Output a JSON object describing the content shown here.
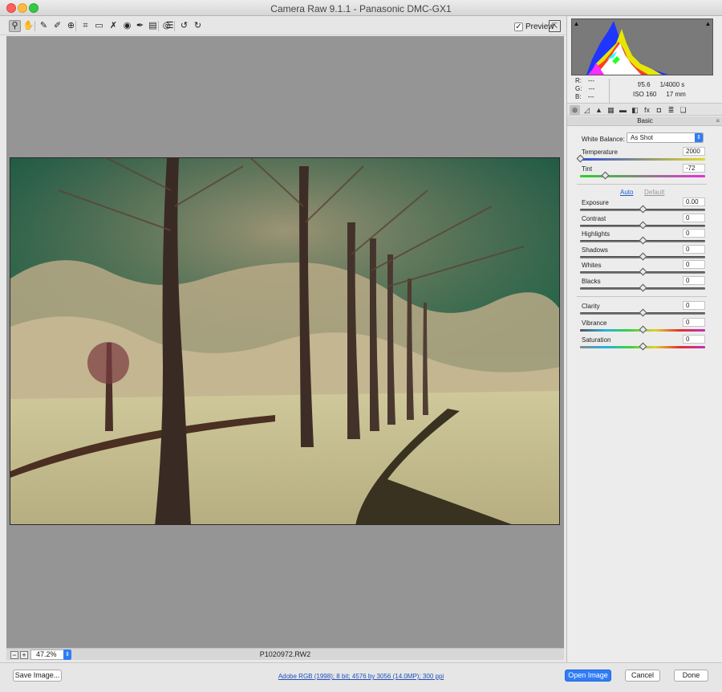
{
  "window": {
    "title": "Camera Raw 9.1.1  -  Panasonic DMC-GX1"
  },
  "toolbar": {
    "tools": [
      {
        "name": "zoom-tool",
        "icon": "magnifier-icon",
        "glyph": "⚲"
      },
      {
        "name": "hand-tool",
        "icon": "hand-icon",
        "glyph": "✋"
      },
      {
        "name": "white-balance-tool",
        "icon": "eyedropper-icon",
        "glyph": "✎"
      },
      {
        "name": "color-sampler-tool",
        "icon": "color-sampler-icon",
        "glyph": "✐"
      },
      {
        "name": "targeted-adjustment-tool",
        "icon": "target-adjust-icon",
        "glyph": "⊕"
      },
      {
        "name": "crop-tool",
        "icon": "crop-icon",
        "glyph": "⌗"
      },
      {
        "name": "straighten-tool",
        "icon": "straighten-icon",
        "glyph": "▭"
      },
      {
        "name": "spot-removal-tool",
        "icon": "spot-removal-icon",
        "glyph": "✗"
      },
      {
        "name": "red-eye-tool",
        "icon": "red-eye-icon",
        "glyph": "◉"
      },
      {
        "name": "adjustment-brush-tool",
        "icon": "brush-icon",
        "glyph": "✒"
      },
      {
        "name": "graduated-filter-tool",
        "icon": "graduated-filter-icon",
        "glyph": "▤"
      },
      {
        "name": "radial-filter-tool",
        "icon": "radial-filter-icon",
        "glyph": "◎"
      },
      {
        "name": "preferences-tool",
        "icon": "list-icon",
        "glyph": "☰"
      },
      {
        "name": "rotate-left-tool",
        "icon": "rotate-left-icon",
        "glyph": "↺"
      },
      {
        "name": "rotate-right-tool",
        "icon": "rotate-right-icon",
        "glyph": "↻"
      }
    ],
    "preview_label": "Preview",
    "preview_check": "✓"
  },
  "canvas": {
    "filename": "P1020972.RW2",
    "zoom_value": "47.2%",
    "zoom_out": "−",
    "zoom_in": "+",
    "zoom_step": "⇕"
  },
  "readout": {
    "r_label": "R:",
    "r_value": "---",
    "g_label": "G:",
    "g_value": "---",
    "b_label": "B:",
    "b_value": "---",
    "aperture": "f/5.6",
    "shutter": "1/4000 s",
    "iso": "ISO 160",
    "focal": "17 mm"
  },
  "panel_tabs": [
    {
      "name": "tab-basic",
      "glyph": "⊛"
    },
    {
      "name": "tab-tone-curve",
      "glyph": "◿"
    },
    {
      "name": "tab-detail",
      "glyph": "▲"
    },
    {
      "name": "tab-hsl",
      "glyph": "▦"
    },
    {
      "name": "tab-split-toning",
      "glyph": "▬"
    },
    {
      "name": "tab-lens",
      "glyph": "◧"
    },
    {
      "name": "tab-effects",
      "glyph": "fx"
    },
    {
      "name": "tab-camera-calibration",
      "glyph": "◘"
    },
    {
      "name": "tab-presets",
      "glyph": "≣"
    },
    {
      "name": "tab-snapshots",
      "glyph": "❏"
    }
  ],
  "basic": {
    "header": "Basic",
    "white_balance_label": "White Balance:",
    "white_balance_value": "As Shot",
    "auto_label": "Auto",
    "default_label": "Default",
    "controls": [
      {
        "name": "temperature",
        "label": "Temperature",
        "value": "2000",
        "level": 0.0,
        "track": "temp"
      },
      {
        "name": "tint",
        "label": "Tint",
        "value": "-72",
        "level": 0.2,
        "track": "tint"
      },
      {
        "name": "exposure",
        "label": "Exposure",
        "value": "0.00",
        "level": 0.5,
        "track": ""
      },
      {
        "name": "contrast",
        "label": "Contrast",
        "value": "0",
        "level": 0.5,
        "track": ""
      },
      {
        "name": "highlights",
        "label": "Highlights",
        "value": "0",
        "level": 0.5,
        "track": ""
      },
      {
        "name": "shadows",
        "label": "Shadows",
        "value": "0",
        "level": 0.5,
        "track": ""
      },
      {
        "name": "whites",
        "label": "Whites",
        "value": "0",
        "level": 0.5,
        "track": ""
      },
      {
        "name": "blacks",
        "label": "Blacks",
        "value": "0",
        "level": 0.5,
        "track": ""
      },
      {
        "name": "clarity",
        "label": "Clarity",
        "value": "0",
        "level": 0.5,
        "track": ""
      },
      {
        "name": "vibrance",
        "label": "Vibrance",
        "value": "0",
        "level": 0.5,
        "track": "vib"
      },
      {
        "name": "saturation",
        "label": "Saturation",
        "value": "0",
        "level": 0.5,
        "track": "sat"
      }
    ]
  },
  "bottom": {
    "save_label": "Save Image...",
    "workflow_label": "Adobe RGB (1998); 8 bit; 4576 by 3056 (14.0MP); 300 ppi",
    "open_label": "Open Image",
    "cancel_label": "Cancel",
    "done_label": "Done"
  },
  "colors": {
    "accent": "#2f7cf6"
  }
}
